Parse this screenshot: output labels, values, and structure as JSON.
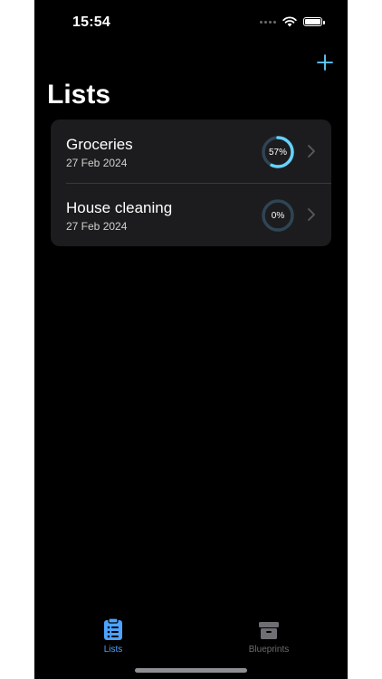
{
  "status_bar": {
    "time": "15:54"
  },
  "header": {
    "title": "Lists",
    "add_icon": "plus-icon"
  },
  "lists": [
    {
      "name": "Groceries",
      "date": "27 Feb 2024",
      "progress_label": "57%",
      "progress": 0.57
    },
    {
      "name": "House cleaning",
      "date": "27 Feb 2024",
      "progress_label": "0%",
      "progress": 0.0
    }
  ],
  "tab_bar": {
    "tabs": [
      {
        "label": "Lists",
        "icon": "clipboard-list-icon",
        "selected": true
      },
      {
        "label": "Blueprints",
        "icon": "archive-box-icon",
        "selected": false
      }
    ]
  },
  "colors": {
    "background": "#000000",
    "card": "#1c1c1e",
    "accent": "#64d2ff",
    "tab_active": "#4da3ff",
    "tab_inactive": "#6e6e73",
    "ring_track": "#2f4555"
  }
}
